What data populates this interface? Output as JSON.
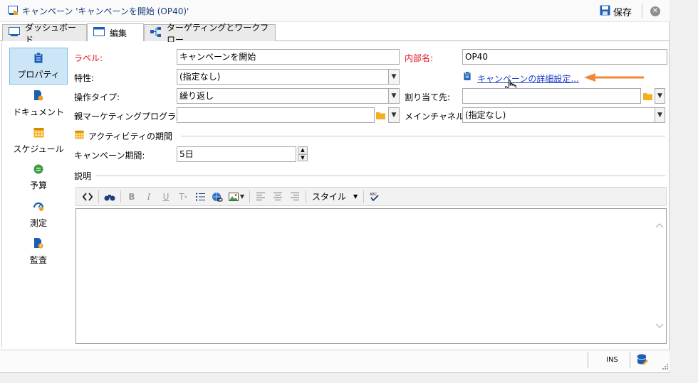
{
  "window": {
    "title": "キャンペーン 'キャンペーンを開始 (OP40)'",
    "save_label": "保存"
  },
  "tabs": [
    {
      "label": "ダッシュボード"
    },
    {
      "label": "編集"
    },
    {
      "label": "ターゲティングとワークフロー"
    }
  ],
  "sidebar": {
    "items": [
      {
        "label": "プロパティ",
        "icon": "clipboard-icon"
      },
      {
        "label": "ドキュメント",
        "icon": "document-icon"
      },
      {
        "label": "スケジュール",
        "icon": "calendar-icon"
      },
      {
        "label": "予算",
        "icon": "coin-icon"
      },
      {
        "label": "測定",
        "icon": "gauge-icon"
      },
      {
        "label": "監査",
        "icon": "audit-icon"
      }
    ]
  },
  "form": {
    "label_label": "ラベル:",
    "label_value": "キャンペーンを開始",
    "internal_name_label": "内部名:",
    "internal_name_value": "OP40",
    "nature_label": "特性:",
    "nature_value": "(指定なし)",
    "advanced_settings_link": "キャンペーンの詳細設定...",
    "operation_type_label": "操作タイプ:",
    "operation_type_value": "繰り返し",
    "assigned_to_label": "割り当て先:",
    "assigned_to_value": "",
    "parent_program_label": "親マーケティングプログラム:",
    "parent_program_value": "",
    "main_channel_label": "メインチャネル:",
    "main_channel_value": "(指定なし)",
    "activity_period_heading": "アクティビティの期間",
    "campaign_period_label": "キャンペーン期間:",
    "campaign_period_value": "5日",
    "description_heading": "説明"
  },
  "editor_toolbar": {
    "style_label": "スタイル"
  },
  "status": {
    "ins": "INS"
  },
  "colors": {
    "required_label": "#e0121b",
    "link": "#1f3ec9",
    "active_nav": "#cde6f7",
    "annotation_arrow": "#f0883a"
  }
}
